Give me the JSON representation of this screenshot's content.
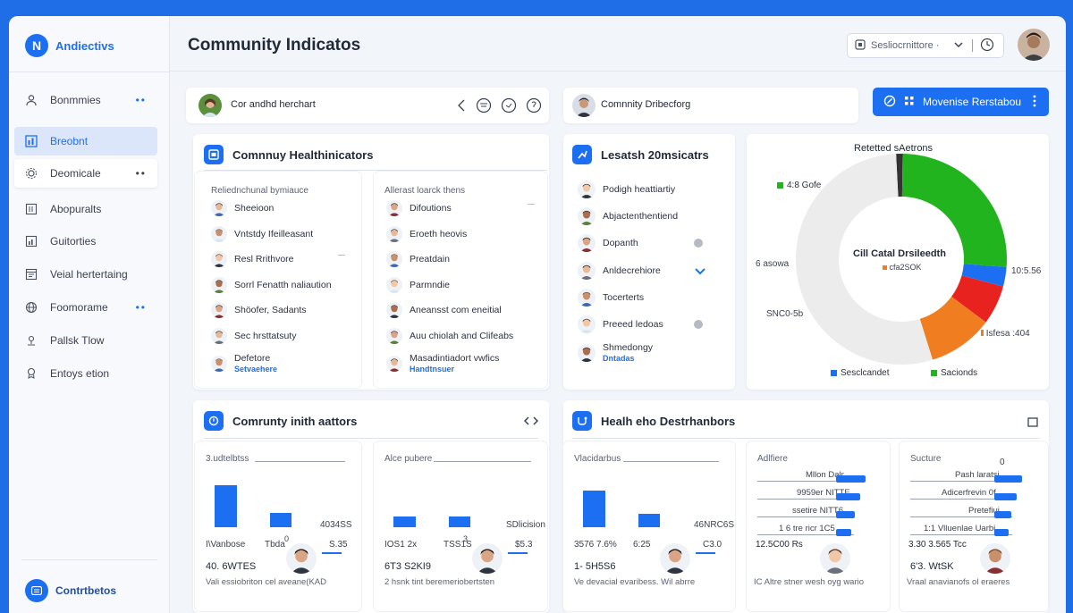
{
  "app": {
    "brand": "Andiectivs",
    "logo_letter": "N",
    "page_title": "Community Indicatos"
  },
  "sidebar": {
    "items": [
      {
        "label": "Bonmmies",
        "icon": "user-icon",
        "dots": "••"
      },
      {
        "label": "Breobnt",
        "icon": "chart-icon",
        "active": true
      },
      {
        "label": "Deomicale",
        "icon": "gear-icon",
        "dots": "••"
      },
      {
        "label": "Abopuralts",
        "icon": "grid-icon"
      },
      {
        "label": "Guitorties",
        "icon": "bars-icon"
      },
      {
        "label": "Veial hertertaing",
        "icon": "window-icon"
      },
      {
        "label": "Foomorame",
        "icon": "globe-icon",
        "dots": "••"
      },
      {
        "label": "Pallsk Tlow",
        "icon": "pin-icon"
      },
      {
        "label": "Entoys etion",
        "icon": "bell-icon"
      }
    ],
    "contrib_label": "Contrtbetos"
  },
  "header": {
    "search_text": "Sesliocrnittore ·"
  },
  "toolbar": {
    "left_title": "Cor andhd herchart",
    "mid_title": "Comnnity Dribecforg",
    "action_label": "Movenise Rerstabou"
  },
  "health": {
    "title": "Comnnuy Healthinicators",
    "col1_header": "Reliednchunal bymiauce",
    "col2_header": "Allerast loarck thens",
    "col1": [
      {
        "label": "Sheeioon"
      },
      {
        "label": "Vntstdy Ifeilleasant"
      },
      {
        "label": "Resl Rrithvore",
        "dash": true
      },
      {
        "label": "Sorrl Fenatth naliaution"
      },
      {
        "label": "Shöofer, Sadants"
      },
      {
        "label": "Sec hrsttatsuty"
      },
      {
        "label": "Defetore",
        "sub": "Setvaehere"
      }
    ],
    "col2": [
      {
        "label": "Difoutions",
        "dash": true
      },
      {
        "label": "Eroeth heovis"
      },
      {
        "label": "Preatdain"
      },
      {
        "label": "Parmndie"
      },
      {
        "label": "Aneansst com eneitial"
      },
      {
        "label": "Auu chiolah and Clifeabs"
      },
      {
        "label": "Masadintiadort vwfics",
        "sub": "Handtnsuer"
      }
    ]
  },
  "research": {
    "title": "Lesatsh 20msicatrs",
    "items": [
      {
        "label": "Podigh heattiartiy"
      },
      {
        "label": "Abjactenthentiend"
      },
      {
        "label": "Dopanth",
        "mark": "dot"
      },
      {
        "label": "Anldecrehiore",
        "mark": "chevron"
      },
      {
        "label": "Tocerterts"
      },
      {
        "label": "Preeed ledoas",
        "mark": "dot"
      },
      {
        "label": "Shmedongy",
        "sub": "Dntadas"
      }
    ]
  },
  "donut": {
    "title": "Retetted sAetrons",
    "center_title": "Cill Catal Drsileedth",
    "center_sub": "cfa2SOK",
    "labels": {
      "top_left": "4:8 Gofe",
      "left": "6 asowa",
      "bottom_left": "SNC0-5b",
      "right": "10:5.56",
      "bottom_right": "Isfesa :404"
    },
    "legend": [
      "Sesclcandet",
      "Sacionds"
    ],
    "colors": {
      "gray": "#ececec",
      "green": "#22b41e",
      "blue": "#1d6ff2",
      "red": "#e8231f",
      "orange": "#f07d1f",
      "dark": "#333333"
    },
    "slices": [
      {
        "color": "dark",
        "value": 1
      },
      {
        "color": "green",
        "value": 26
      },
      {
        "color": "blue",
        "value": 3
      },
      {
        "color": "red",
        "value": 6
      },
      {
        "color": "orange",
        "value": 10
      },
      {
        "color": "gray",
        "value": 54
      }
    ]
  },
  "community_stats": {
    "title": "Comrunty inith aattors",
    "panels": [
      {
        "header": "3.udtelbtss",
        "bars": [
          0.85,
          0.3
        ],
        "label_a": "I\\Vanbose",
        "label_b": "Tbda",
        "axis_top": "0",
        "right_label": "4034SS",
        "right_label2": "S.35",
        "stat": "40. 6WTES",
        "caption": "Vali essiobriton cel aveane(KAD"
      },
      {
        "header": "Alce pubere",
        "bars": [
          0.22,
          0.22
        ],
        "label_a": "IOS1 2x",
        "label_b": "TSS1S",
        "axis_top": "3",
        "right_label": "SDlicision",
        "right_label2": "$5.3",
        "stat": "6T3 S2KI9",
        "caption": "2 hsnk tint beremeriobertsten"
      }
    ]
  },
  "health_dist": {
    "title": "Healh eho Destrhanbors",
    "panels": [
      {
        "header": "Vlacidarbus",
        "bars": [
          0.75,
          0.28
        ],
        "label_a": "3576 7.6%",
        "label_b": "6:25",
        "right_label": "46NRC6S",
        "right_label2": "C3.0",
        "stat": "1- 5H5S6",
        "caption": "Ve devacial evaribess. Wil abrre"
      },
      {
        "header": "Adlfiere",
        "bars_h": [
          {
            "label": "Mllon Dalr",
            "v": 0.7
          },
          {
            "label": "9959er NITTE",
            "v": 0.55
          },
          {
            "label": "ssetire NITT6",
            "v": 0.4
          },
          {
            "label": "1 6 tre ricr 1C5",
            "v": 0.3
          }
        ],
        "stat": "12.5C00 Rs",
        "caption": "IC Altre stner wesh oyg wario"
      },
      {
        "header": "Sucture",
        "axis_top": "0",
        "bars_h": [
          {
            "label": "Pash laratsi",
            "v": 0.65
          },
          {
            "label": "Adicerfrevin 0f",
            "v": 0.5
          },
          {
            "label": "Pretefiui",
            "v": 0.35
          },
          {
            "label": "1:1 Vlluenlae Uarbi",
            "v": 0.25
          }
        ],
        "stat": "3.30 3.565 Tcc",
        "caption2": "6'3. WtSK",
        "caption": "Vraal anavianofs ol eraeres"
      }
    ]
  }
}
